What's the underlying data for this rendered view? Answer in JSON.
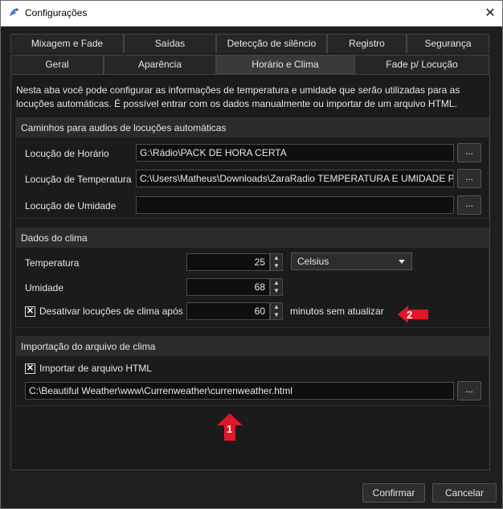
{
  "window": {
    "title": "Configurações",
    "close_glyph": "✕",
    "icon": "app-logo-icon"
  },
  "tabs_row1": [
    {
      "label": "Mixagem e Fade"
    },
    {
      "label": "Saídas"
    },
    {
      "label": "Detecção de silêncio"
    },
    {
      "label": "Registro"
    },
    {
      "label": "Segurança"
    }
  ],
  "tabs_row2": [
    {
      "label": "Geral"
    },
    {
      "label": "Aparência"
    },
    {
      "label": "Horário e Clima",
      "active": true
    },
    {
      "label": "Fade p/ Locução"
    }
  ],
  "description": "Nesta aba você pode configurar as informações de temperatura e umidade que serão utilizadas para as locuções automáticas. É possível entrar com os dados manualmente ou importar de um arquivo HTML.",
  "paths_group": {
    "title": "Caminhos para audios de locuções automáticas",
    "rows": [
      {
        "label": "Locução de Horário",
        "value": "G:\\Rádio\\PACK DE HORA CERTA",
        "button": "..."
      },
      {
        "label": "Locução de Temperatura",
        "value": "C:\\Users\\Matheus\\Downloads\\ZaraRadio TEMPERATURA E UMIDADE PERS",
        "button": "..."
      },
      {
        "label": "Locução de Umidade",
        "value": "",
        "button": "..."
      }
    ]
  },
  "climate_group": {
    "title": "Dados do clima",
    "temperature_label": "Temperatura",
    "temperature_value": "25",
    "unit_selected": "Celsius",
    "humidity_label": "Umidade",
    "humidity_value": "68",
    "disable_label": "Desativar locuções de clima após",
    "disable_checked": true,
    "disable_minutes": "60",
    "minutes_suffix": "minutos sem atualizar"
  },
  "import_group": {
    "title": "Importação do arquivo de clima",
    "checkbox_label": "Importar de arquivo HTML",
    "checked": true,
    "file_path": "C:\\Beautiful Weather\\www\\Currenweather\\currenweather.html",
    "button": "..."
  },
  "footer": {
    "confirm": "Confirmar",
    "cancel": "Cancelar"
  },
  "annotations": [
    {
      "number": "1",
      "color": "#e0162b"
    },
    {
      "number": "2",
      "color": "#e0162b"
    }
  ],
  "check_glyph": "✕",
  "spin_up": "▲",
  "spin_down": "▼"
}
